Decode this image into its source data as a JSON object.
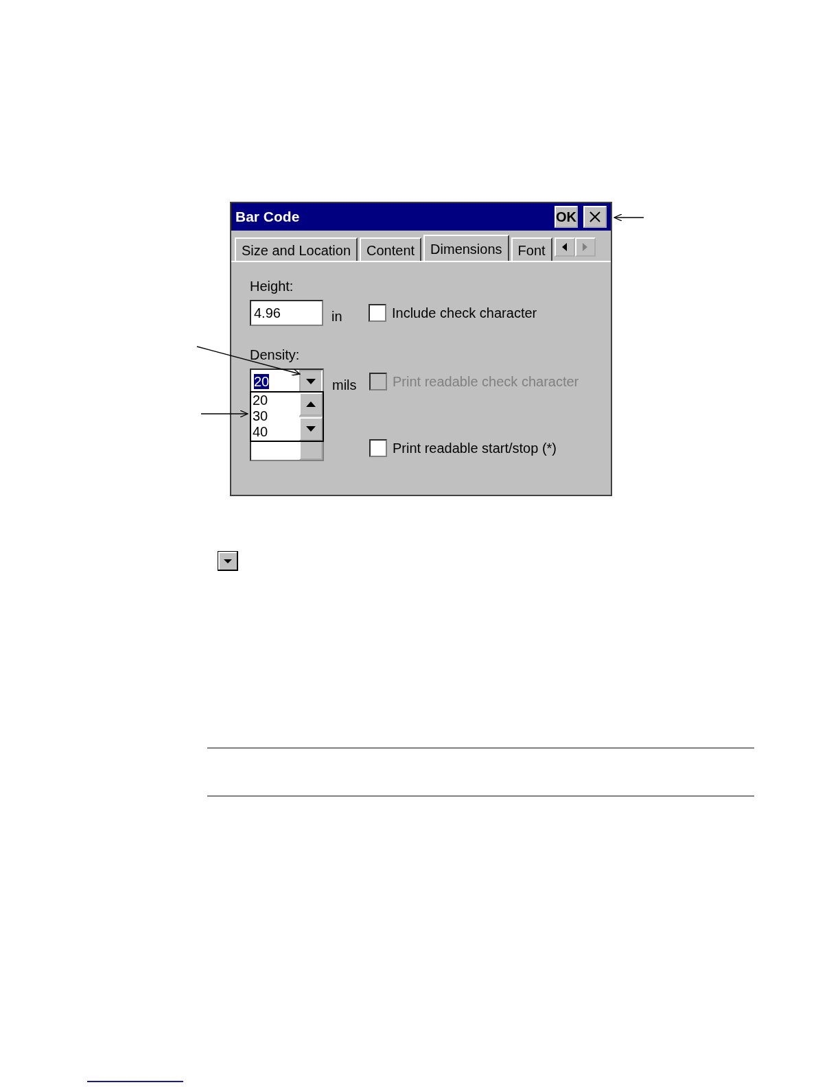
{
  "window": {
    "title": "Bar Code",
    "ok_button": "OK"
  },
  "tabs": [
    {
      "label": "Size and Location",
      "selected": false
    },
    {
      "label": "Content",
      "selected": false
    },
    {
      "label": "Dimensions",
      "selected": true
    },
    {
      "label": "Font",
      "selected": false
    }
  ],
  "height": {
    "label": "Height:",
    "value": "4.96",
    "unit": "in"
  },
  "density": {
    "label": "Density:",
    "value": "20",
    "unit": "mils",
    "expanded": true,
    "options": [
      {
        "label": "20"
      },
      {
        "label": "30"
      },
      {
        "label": "40"
      }
    ]
  },
  "checkboxes": [
    {
      "label": "Include check character",
      "checked": false,
      "disabled": false
    },
    {
      "label": "Print readable check character",
      "checked": false,
      "disabled": true
    },
    {
      "label": "Print readable start/stop (*)",
      "checked": false,
      "disabled": false
    }
  ]
}
